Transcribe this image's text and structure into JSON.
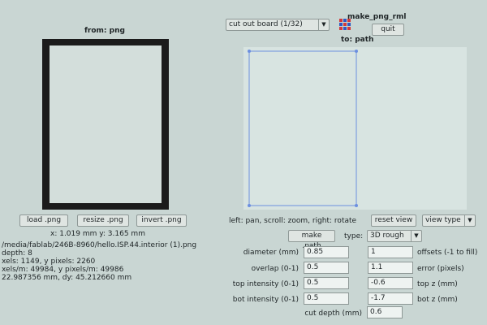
{
  "window": {
    "title": "make_png_rml"
  },
  "toolbar": {
    "mode_select": "cut out board (1/32)",
    "quit_label": "quit"
  },
  "left_panel": {
    "title": "from: png",
    "coords": "x: 1.019 mm  y: 3.165 mm",
    "buttons": {
      "load": "load .png",
      "resize": "resize .png",
      "invert": "invert .png"
    },
    "info": [
      "/media/fablab/246B-8960/hello.ISP.44.interior (1).png",
      "depth: 8",
      "xels: 1149, y pixels: 2260",
      "xels/m: 49984, y pixels/m: 49986",
      "22.987356 mm, dy: 45.212660 mm"
    ]
  },
  "right_panel": {
    "title": "to: path",
    "hint": "left: pan, scroll: zoom, right: rotate",
    "reset_view": "reset view",
    "view_type": "view type",
    "make_path": "make .path",
    "type_label": "type:",
    "type_value": "3D rough"
  },
  "params": [
    {
      "label": "diameter (mm)",
      "value": "0.85",
      "right_value": "1",
      "right_label": "offsets (-1 to fill)"
    },
    {
      "label": "overlap (0-1)",
      "value": "0.5",
      "right_value": "1.1",
      "right_label": "error (pixels)"
    },
    {
      "label": "top intensity (0-1)",
      "value": "0.5",
      "right_value": "-0.6",
      "right_label": "top z (mm)"
    },
    {
      "label": "bot intensity (0-1)",
      "value": "0.5",
      "right_value": "-1.7",
      "right_label": "bot z (mm)"
    }
  ],
  "cut_depth": {
    "label": "cut depth (mm)",
    "value": "0.6"
  },
  "colors": {
    "accent_path": "#6c8fe0",
    "board_frame": "#1b1b1b"
  }
}
